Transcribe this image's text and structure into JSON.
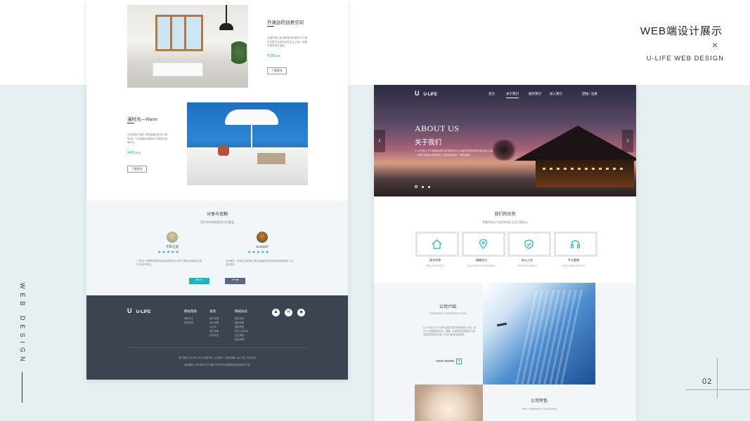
{
  "header": {
    "title": "WEB端设计展示",
    "close_glyph": "×",
    "subtitle": "U-LIFE WEB DESIGN"
  },
  "side": {
    "vertical_text": "WEB DESIGN"
  },
  "page_number": "02",
  "left_page": {
    "card1": {
      "title": "外滩边的创意空间",
      "text": "坐拥外滩江景,感受城市的繁华与宁静,在这里开启你的创意生活,让每一刻都充满灵感与温度。",
      "price": "¥288",
      "unit": "/每晚",
      "button": "了解更多"
    },
    "card2": {
      "title": "漫时光—Warm",
      "text": "在这里慢下脚步,享受温暖的阳光与海风,每一个角落都充满舒适与惬意的度假时光。",
      "price": "¥465",
      "unit": "/每晚",
      "button": "了解更多"
    },
    "share": {
      "title": "分享与信赖",
      "subtitle": "您所有的旅程都是久别重逢",
      "reviews": [
        {
          "name": "千年之逗",
          "stars": "★★★★★",
          "text": "\"一直\"是一家很有格调的民宿,老板很热情,房间干净整洁,推荐给大家,下次还会再来住。"
        },
        {
          "name": "Sundy67",
          "stars": "★★★★★",
          "text": "非常棒的一次体验,位置很好,周边交通便利,房间布置得很有格调,下次还会再来。"
        }
      ],
      "prev": "⟵",
      "next": "⟶"
    },
    "footer": {
      "logo": "U",
      "brand": "U-LIFE",
      "col1_title": "网站帮助",
      "col1_items": [
        "帮助中心",
        "联系我们"
      ],
      "col2_title": "发现",
      "col2_items": [
        "城市民宿",
        "旅行攻略",
        "礼品卡",
        "房东指南",
        "民宿动态"
      ],
      "col3_title": "网站协议",
      "col3_items": [
        "服务协议",
        "隐私政策",
        "退款规则",
        "房东入驻协议",
        "社区规则",
        "版权声明"
      ],
      "social": [
        "♟",
        "✉",
        "◉"
      ],
      "copy1": "客户服务:400-000-0000 | 帮助中心 | 公司简介 | 网站地图 | App下载 | 意见反馈",
      "copy2": "网站备案 | 许可证号:沪ICP备12345678号 增值电信业务经营许可证"
    }
  },
  "right_page": {
    "nav": {
      "logo": "U",
      "brand": "U-LIFE",
      "items": [
        "首页",
        "关于我们",
        "服务我们",
        "加入我们"
      ],
      "active": "关于我们",
      "login": "登陆 / 注册"
    },
    "hero": {
      "title": "ABOUT US",
      "subtitle": "关于我们",
      "text": "U-LIFE致力于打造高品质的民宿体验平台,连接世界各地的特色民宿,让每一次旅行都成为美好回忆,让旅客感受家一般的温暖。",
      "prev": "‹",
      "next": "›"
    },
    "advantages": {
      "title": "我们的优势",
      "subtitle": "完美的安全与信用机制,让出行更安心",
      "items": [
        {
          "label": "真实房源",
          "en": "REAL PROPERTY",
          "icon": "home-icon"
        },
        {
          "label": "精确定位",
          "en": "ACCURATE POSITIONING",
          "icon": "location-pin-icon"
        },
        {
          "label": "安心入住",
          "en": "PEACE OF MIND IN",
          "icon": "shield-check-icon"
        },
        {
          "label": "专业客服",
          "en": "CUSTOMER SERVICE",
          "icon": "headset-icon"
        }
      ]
    },
    "intro": {
      "title": "公司介绍",
      "en": "COMPANY INTRODUCTION",
      "text": "U-LIFE创立于2016年,是国内领先的民宿预订平台。致力于为旅客提供安全、便捷、高品质的住宿服务,汇聚全球优质房源,让每一次出行都有家的感觉。",
      "more": "VIEW MORE",
      "more_icon": "+"
    },
    "features": {
      "title": "公司特色",
      "en": "THE COMPANY FEATURES"
    }
  },
  "colors": {
    "accent": "#1fb3c0",
    "footer": "#3c4351",
    "band": "#e6f0f2"
  }
}
